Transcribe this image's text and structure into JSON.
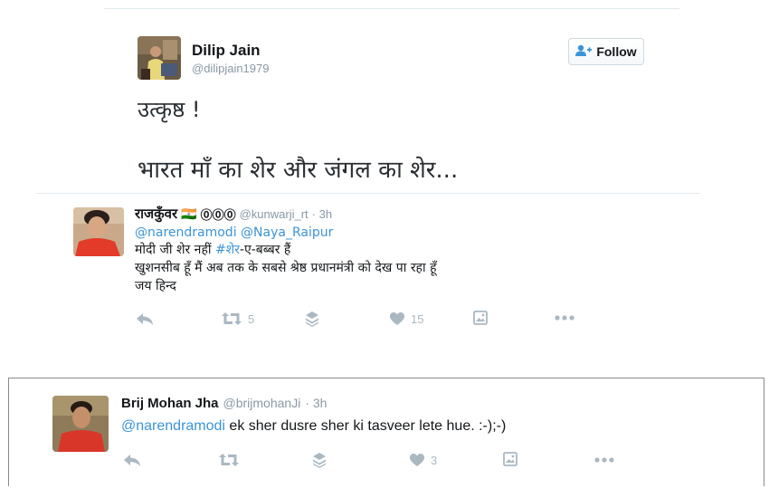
{
  "main_tweet": {
    "author_name": "Dilip Jain",
    "author_handle": "@dilipjain1979",
    "follow_label": "Follow",
    "line1": "उत्कृष्ठ !",
    "line2": "भारत माँ का शेर और जंगल का शेर..."
  },
  "reply1": {
    "author_name": "राजकुँवर",
    "flag": "🇮🇳",
    "symbols": "⓪⓪⓪",
    "author_handle": "@kunwarji_rt",
    "time": "· 3h",
    "mention1": "@narendramodi",
    "mention2": "@Naya_Raipur",
    "line1_prefix": "मोदी जी शेर नहीं ",
    "line1_hashtag": "#शेर",
    "line1_suffix": "-ए-बब्बर हैं",
    "line2": "खुशनसीब हूँ मैं अब तक के सबसे श्रेष्ठ प्रधानमंत्री को देख पा रहा हूँ",
    "line3": "जय हिन्द",
    "retweets": "5",
    "likes": "15"
  },
  "reply2": {
    "author_name": "Brij Mohan Jha",
    "author_handle": "@brijmohanJi",
    "time": "· 3h",
    "mention": "@narendramodi",
    "text": " ek sher dusre sher ki tasveer lete hue. :-);-)",
    "likes": "3"
  },
  "colors": {
    "link": "#3b94d9",
    "handle": "#8899a6",
    "action": "#aab8c2",
    "divider": "#e1e8ed"
  },
  "icons": [
    "reply-icon",
    "retweet-icon",
    "stack-icon",
    "heart-icon",
    "media-icon",
    "more-icon",
    "add-user-icon"
  ]
}
